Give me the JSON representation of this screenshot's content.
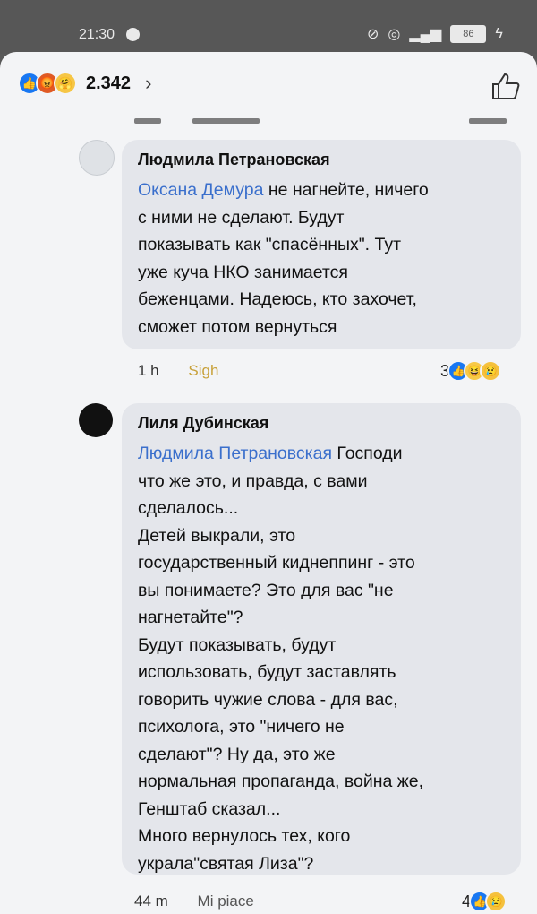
{
  "status_bar": {
    "time": "21:30",
    "battery": "86"
  },
  "reactions_header": {
    "count": "2.342",
    "chevron": "›",
    "emoji_icons": [
      "like-icon",
      "angry-icon",
      "care-icon"
    ]
  },
  "comments": [
    {
      "author": "Людмила Петрановская",
      "mention": "Оксана Демура",
      "text_after_mention": " не нагнейте, ничего\nс ними не сделают. Будут\nпоказывать как \"спасённых\". Тут\nуже куча НКО занимается\nбеженцами. Надеюсь, кто захочет,\nсможет потом вернуться",
      "time": "1 h",
      "like_label": "Sigh",
      "reaction_count": "3",
      "reaction_icons": [
        "like-icon",
        "haha-icon",
        "sad-icon"
      ]
    },
    {
      "author": "Лиля Дубинская",
      "mention": "Людмила Петрановская",
      "text_after_mention": " Господи\nчто же это, и правда, с вами\nсделалось...\nДетей выкрали, это\nгосударственный киднеппинг - это\nвы понимаете? Это для вас \"не\nнагнетайте\"?\nБудут показывать, будут\nиспользовать, будут заставлять\nговорить чужие слова - для вас,\nпсихолога, это \"ничего не\nсделают\"? Ну да, это же\nнормальная пропаганда, война же,\nГенштаб сказал...\nМного вернулось тех, кого\nукрала\"святая Лиза\"?",
      "time": "44 m",
      "like_label": "Mi piace",
      "reaction_count": "4",
      "reaction_icons": [
        "like-icon",
        "sad-icon"
      ]
    }
  ]
}
